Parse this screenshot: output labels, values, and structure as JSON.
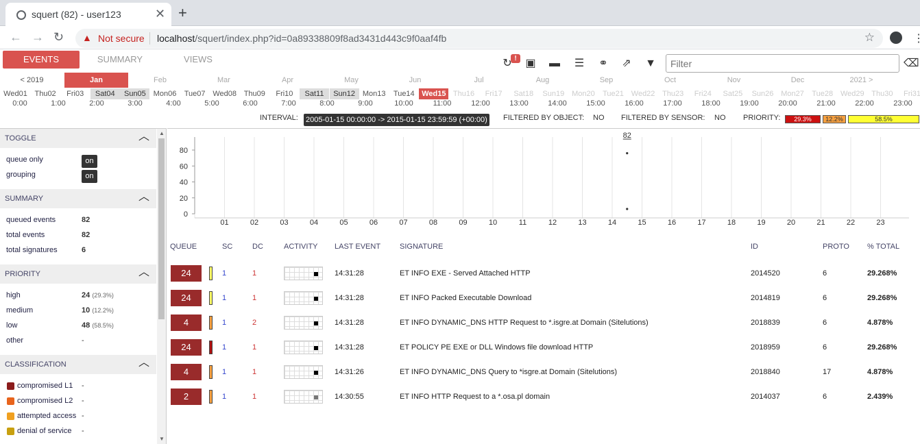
{
  "browser": {
    "tab_title": "squert (82) - user123",
    "security_label": "Not secure",
    "url_host": "localhost",
    "url_path": "/squert/index.php?id=0a89338809f8ad3431d443c9f0aaf4fb"
  },
  "nav": {
    "events": "EVENTS",
    "summary": "SUMMARY",
    "views": "VIEWS"
  },
  "toolbar": {
    "badge": "!",
    "filter_placeholder": "Filter"
  },
  "months": [
    "< 2019",
    "Jan",
    "Feb",
    "Mar",
    "Apr",
    "May",
    "Jun",
    "Jul",
    "Aug",
    "Sep",
    "Oct",
    "Nov",
    "Dec",
    "2021 >"
  ],
  "days": [
    "Wed01",
    "Thu02",
    "Fri03",
    "Sat04",
    "Sun05",
    "Mon06",
    "Tue07",
    "Wed08",
    "Thu09",
    "Fri10",
    "Sat11",
    "Sun12",
    "Mon13",
    "Tue14",
    "Wed15",
    "Thu16",
    "Fri17",
    "Sat18",
    "Sun19",
    "Mon20",
    "Tue21",
    "Wed22",
    "Thu23",
    "Fri24",
    "Sat25",
    "Sun26",
    "Mon27",
    "Tue28",
    "Wed29",
    "Thu30",
    "Fri31"
  ],
  "hours": [
    "0:00",
    "1:00",
    "2:00",
    "3:00",
    "4:00",
    "5:00",
    "6:00",
    "7:00",
    "8:00",
    "9:00",
    "10:00",
    "11:00",
    "12:00",
    "13:00",
    "14:00",
    "15:00",
    "16:00",
    "17:00",
    "18:00",
    "19:00",
    "20:00",
    "21:00",
    "22:00",
    "23:00"
  ],
  "info": {
    "interval_label": "INTERVAL:",
    "interval_value": "2005-01-15 00:00:00 -> 2015-01-15 23:59:59 (+00:00)",
    "filtered_object_label": "FILTERED BY OBJECT:",
    "filtered_object_value": "NO",
    "filtered_sensor_label": "FILTERED BY SENSOR:",
    "filtered_sensor_value": "NO",
    "priority_label": "PRIORITY:",
    "priority_high": "29.3%",
    "priority_medium": "12.2%",
    "priority_low": "58.5%"
  },
  "sidebar": {
    "toggle": {
      "title": "TOGGLE",
      "queue_only": "queue only",
      "grouping": "grouping",
      "on": "on"
    },
    "summary": {
      "title": "SUMMARY",
      "queued_label": "queued events",
      "queued": "82",
      "total_label": "total events",
      "total": "82",
      "sigs_label": "total signatures",
      "sigs": "6"
    },
    "priority": {
      "title": "PRIORITY",
      "high": "high",
      "high_val": "24",
      "high_pct": "(29.3%)",
      "medium": "medium",
      "medium_val": "10",
      "medium_pct": "(12.2%)",
      "low": "low",
      "low_val": "48",
      "low_pct": "(58.5%)",
      "other": "other",
      "other_val": "-"
    },
    "classification": {
      "title": "CLASSIFICATION",
      "items": [
        {
          "label": "compromised L1",
          "value": "-",
          "color": "#8b1c1c"
        },
        {
          "label": "compromised L2",
          "value": "-",
          "color": "#e8641c"
        },
        {
          "label": "attempted access",
          "value": "-",
          "color": "#f0a020"
        },
        {
          "label": "denial of service",
          "value": "-",
          "color": "#c8a010"
        }
      ]
    }
  },
  "chart_data": {
    "type": "scatter",
    "title": "",
    "xlabel": "",
    "ylabel": "",
    "x_ticks": [
      "01",
      "02",
      "03",
      "04",
      "05",
      "06",
      "07",
      "08",
      "09",
      "10",
      "11",
      "12",
      "13",
      "14",
      "15",
      "16",
      "17",
      "18",
      "19",
      "20",
      "21",
      "22",
      "23"
    ],
    "y_ticks": [
      "0",
      "20",
      "40",
      "60",
      "80"
    ],
    "ylim": [
      0,
      90
    ],
    "points": [
      {
        "x": 14.5,
        "y": 76
      },
      {
        "x": 14.5,
        "y": 6
      }
    ],
    "annotation": "82"
  },
  "table": {
    "headers": {
      "queue": "QUEUE",
      "sc": "SC",
      "dc": "DC",
      "activity": "ACTIVITY",
      "last": "LAST EVENT",
      "signature": "SIGNATURE",
      "id": "ID",
      "proto": "PROTO",
      "pct": "% TOTAL"
    },
    "rows": [
      {
        "queue": "24",
        "pri_color": "#ffff66",
        "sc": "1",
        "dc": "1",
        "last": "14:31:28",
        "signature": "ET INFO EXE - Served Attached HTTP",
        "id": "2014520",
        "proto": "6",
        "pct": "29.268%"
      },
      {
        "queue": "24",
        "pri_color": "#ffff66",
        "sc": "1",
        "dc": "1",
        "last": "14:31:28",
        "signature": "ET INFO Packed Executable Download",
        "id": "2014819",
        "proto": "6",
        "pct": "29.268%"
      },
      {
        "queue": "4",
        "pri_color": "#f6a040",
        "sc": "1",
        "dc": "2",
        "last": "14:31:28",
        "signature": "ET INFO DYNAMIC_DNS HTTP Request to *.isgre.at Domain (Sitelutions)",
        "id": "2018839",
        "proto": "6",
        "pct": "4.878%"
      },
      {
        "queue": "24",
        "pri_color": "#b01010",
        "sc": "1",
        "dc": "1",
        "last": "14:31:28",
        "signature": "ET POLICY PE EXE or DLL Windows file download HTTP",
        "id": "2018959",
        "proto": "6",
        "pct": "29.268%"
      },
      {
        "queue": "4",
        "pri_color": "#f6a040",
        "sc": "1",
        "dc": "1",
        "last": "14:31:26",
        "signature": "ET INFO DYNAMIC_DNS Query to *isgre.at Domain (Sitelutions)",
        "id": "2018840",
        "proto": "17",
        "pct": "4.878%"
      },
      {
        "queue": "2",
        "pri_color": "#f6a040",
        "sc": "1",
        "dc": "1",
        "last": "14:30:55",
        "signature": "ET INFO HTTP Request to a *.osa.pl domain",
        "id": "2014037",
        "proto": "6",
        "pct": "2.439%"
      }
    ]
  }
}
